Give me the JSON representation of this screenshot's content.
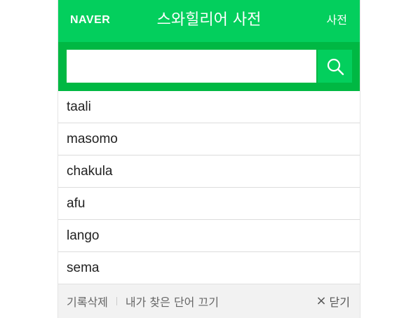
{
  "header": {
    "logo": "NAVER",
    "title": "스와힐리어 사전",
    "dict_link": "사전"
  },
  "search": {
    "value": "",
    "placeholder": ""
  },
  "recent_words": [
    "taali",
    "masomo",
    "chakula",
    "afu",
    "lango",
    "sema"
  ],
  "footer": {
    "delete_history": "기록삭제",
    "disable_history": "내가 찾은 단어 끄기",
    "close_icon": "×",
    "close": "닫기"
  },
  "colors": {
    "brand": "#03cf5d",
    "search_bar": "#00b843"
  }
}
